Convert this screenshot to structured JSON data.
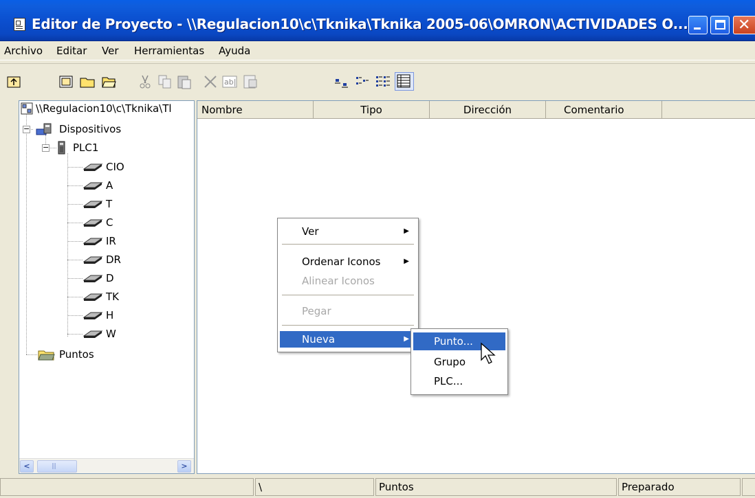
{
  "window": {
    "title": "Editor de Proyecto - \\\\Regulacion10\\c\\Tknika\\Tknika 2005-06\\OMRON\\ACTIVIDADES O..."
  },
  "menubar": {
    "items": [
      "Archivo",
      "Editar",
      "Ver",
      "Herramientas",
      "Ayuda"
    ]
  },
  "toolbar": {
    "icons": [
      "up-folder-icon",
      "new-project-icon",
      "open-folder-icon",
      "open-file-icon",
      "cut-icon",
      "copy-icon",
      "paste-icon",
      "delete-icon",
      "rename-icon",
      "properties-icon",
      "large-icons-icon",
      "small-icons-icon",
      "list-view-icon",
      "details-view-icon"
    ]
  },
  "tree": {
    "root": "\\\\Regulacion10\\c\\Tknika\\Tl",
    "dispositivos": "Dispositivos",
    "plc": "PLC1",
    "areas": [
      "CIO",
      "A",
      "T",
      "C",
      "IR",
      "DR",
      "D",
      "TK",
      "H",
      "W"
    ],
    "puntos": "Puntos"
  },
  "list": {
    "columns": [
      "Nombre",
      "Tipo",
      "Dirección",
      "Comentario"
    ]
  },
  "context_menu": {
    "ver": "Ver",
    "ordenar": "Ordenar Iconos",
    "alinear": "Alinear Iconos",
    "pegar": "Pegar",
    "nueva": "Nueva"
  },
  "submenu": {
    "items": [
      "Punto...",
      "Grupo",
      "PLC..."
    ]
  },
  "statusbar": {
    "path": "\\",
    "location": "Puntos",
    "status": "Preparado"
  },
  "colors": {
    "titlebar": "#0b4fcf",
    "highlight": "#316ac5",
    "face": "#ece9d8"
  }
}
